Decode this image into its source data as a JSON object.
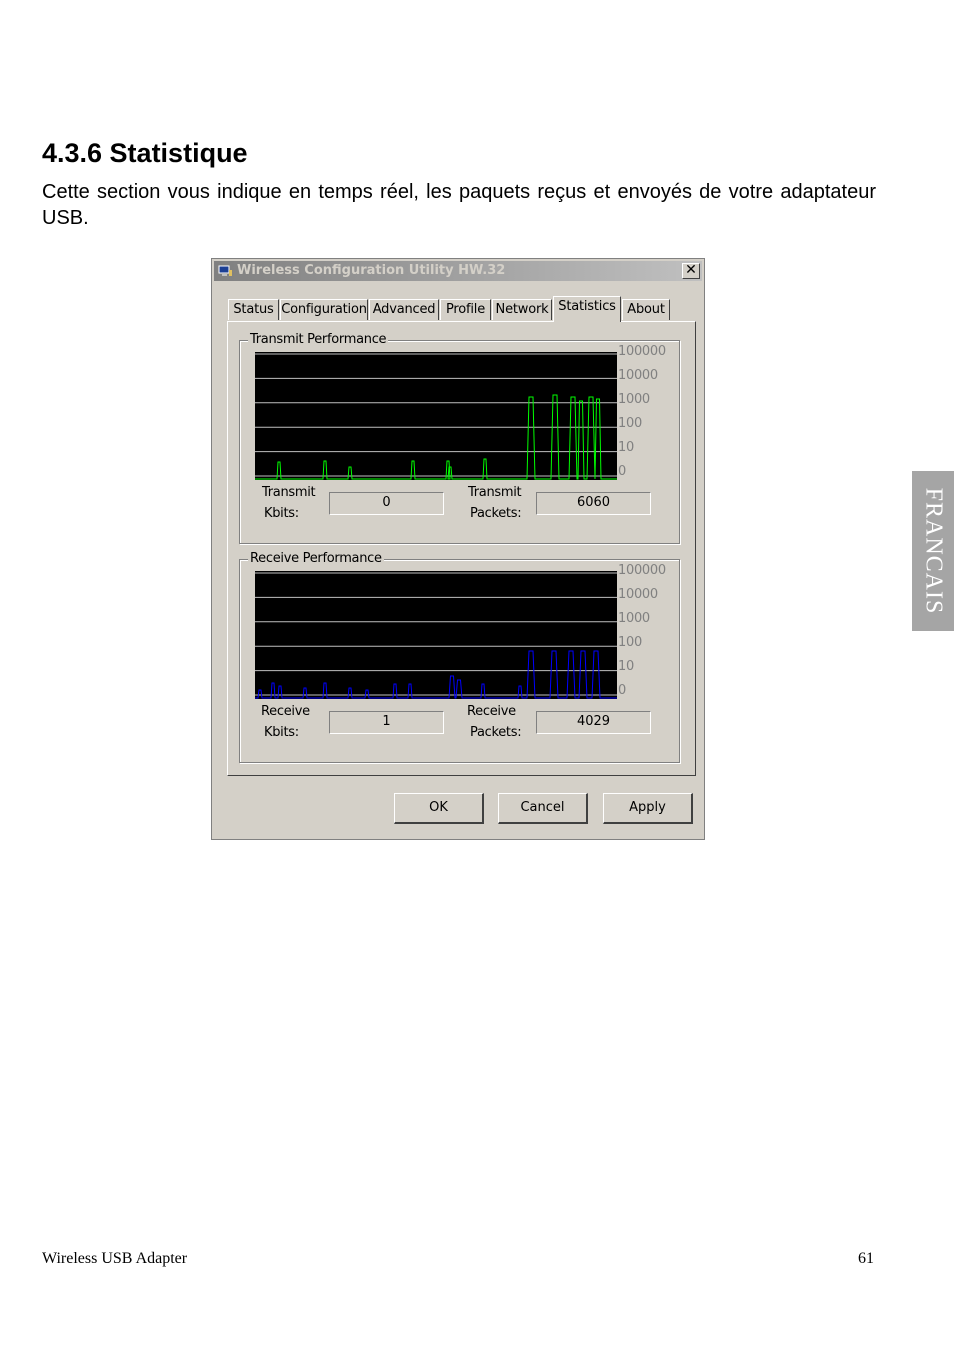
{
  "heading": "4.3.6 Statistique",
  "paragraph": "Cette section vous indique en temps réel, les paquets reçus et envoyés de votre adaptateur USB.",
  "side_tab": "FRANCAIS",
  "footer": {
    "left": "Wireless USB Adapter",
    "right": "61"
  },
  "dialog": {
    "title": "Wireless Configuration Utility HW.32",
    "close_label": "✕",
    "tabs": [
      "Status",
      "Configuration",
      "Advanced",
      "Profile",
      "Network",
      "Statistics",
      "About"
    ],
    "active_tab": "Statistics",
    "transmit": {
      "group_label": "Transmit Performance",
      "axis_labels": [
        "100000",
        "10000",
        "1000",
        "100",
        "10",
        "0"
      ],
      "kbits_label_1": "Transmit",
      "kbits_label_2": "Kbits:",
      "kbits_value": "0",
      "packets_label_1": "Transmit",
      "packets_label_2": "Packets:",
      "packets_value": "6060",
      "line_color": "#00ff00"
    },
    "receive": {
      "group_label": "Receive Performance",
      "axis_labels": [
        "100000",
        "10000",
        "1000",
        "100",
        "10",
        "0"
      ],
      "kbits_label_1": "Receive",
      "kbits_label_2": "Kbits:",
      "kbits_value": "1",
      "packets_label_1": "Receive",
      "packets_label_2": "Packets:",
      "packets_value": "4029",
      "line_color": "#0000ff"
    },
    "buttons": {
      "ok": "OK",
      "cancel": "Cancel",
      "apply": "Apply"
    }
  }
}
